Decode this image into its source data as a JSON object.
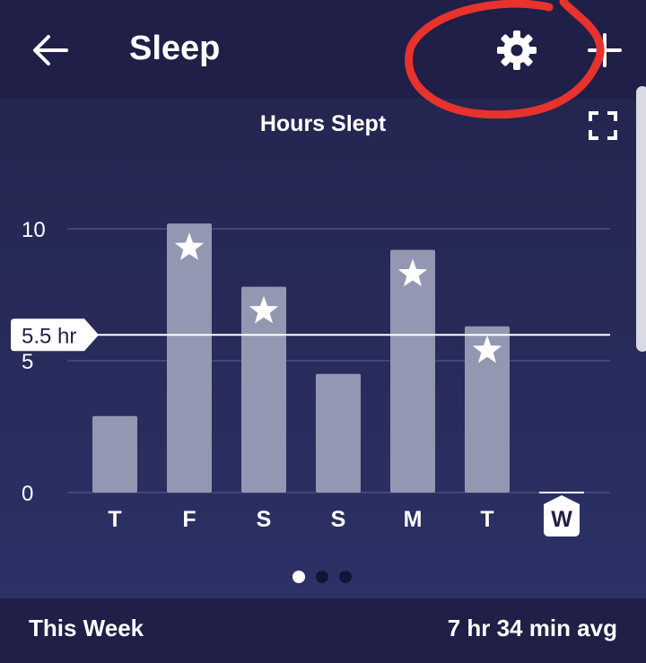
{
  "app_bar": {
    "title": "Sleep",
    "back_icon": "arrow-left-icon",
    "settings_icon": "gear-icon",
    "add_icon": "plus-icon",
    "annotation_color": "#e8322d"
  },
  "chart_data": {
    "type": "bar",
    "title": "Hours Slept",
    "categories": [
      "T",
      "F",
      "S",
      "S",
      "M",
      "T",
      "W"
    ],
    "values": [
      2.9,
      10.2,
      7.8,
      4.5,
      9.2,
      6.3,
      0
    ],
    "starred": [
      false,
      true,
      true,
      false,
      true,
      true,
      false
    ],
    "selected_category_index": 6,
    "y_ticks": [
      "10",
      "5",
      "0"
    ],
    "ylim": [
      0,
      10
    ],
    "goal": {
      "value": 5.5,
      "label": "5.5 hr"
    },
    "bar_color": "#9497b1",
    "star_color": "#ffffff",
    "grid": true
  },
  "pager": {
    "pages": 3,
    "active": 0
  },
  "footer": {
    "period": "This Week",
    "average": "7 hr 34 min avg"
  }
}
